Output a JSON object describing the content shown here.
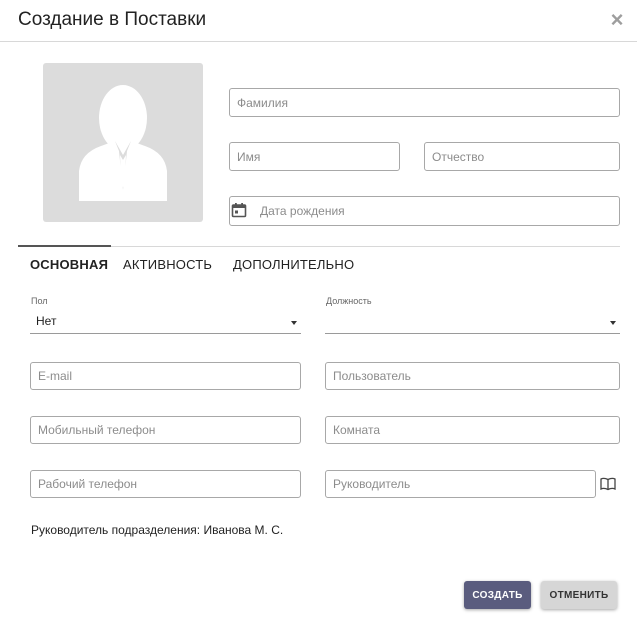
{
  "dialog": {
    "title": "Создание в Поставки",
    "close_symbol": "×"
  },
  "person": {
    "lastname_placeholder": "Фамилия",
    "firstname_placeholder": "Имя",
    "middlename_placeholder": "Отчество",
    "birthdate_placeholder": "Дата рождения"
  },
  "tabs": [
    {
      "label": "ОСНОВНАЯ",
      "active": true
    },
    {
      "label": "АКТИВНОСТЬ",
      "active": false
    },
    {
      "label": "ДОПОЛНИТЕЛЬНО",
      "active": false
    }
  ],
  "form": {
    "gender_label": "Пол",
    "gender_value": "Нет",
    "position_label": "Должность",
    "position_value": "",
    "email_placeholder": "E-mail",
    "user_placeholder": "Пользователь",
    "mobile_placeholder": "Мобильный телефон",
    "room_placeholder": "Комната",
    "work_phone_placeholder": "Рабочий телефон",
    "manager_placeholder": "Руководитель"
  },
  "department_head_text": "Руководитель подразделения: Иванова М. С.",
  "buttons": {
    "create": "СОЗДАТЬ",
    "cancel": "ОТМЕНИТЬ"
  },
  "colors": {
    "primary_button": "#5a5c7e",
    "secondary_button": "#d6d6d6",
    "avatar_bg": "#dcdcdc"
  },
  "icons": {
    "avatar": "person-silhouette-icon",
    "calendar": "calendar-icon",
    "manager_lookup": "book-icon",
    "close": "close-icon"
  }
}
